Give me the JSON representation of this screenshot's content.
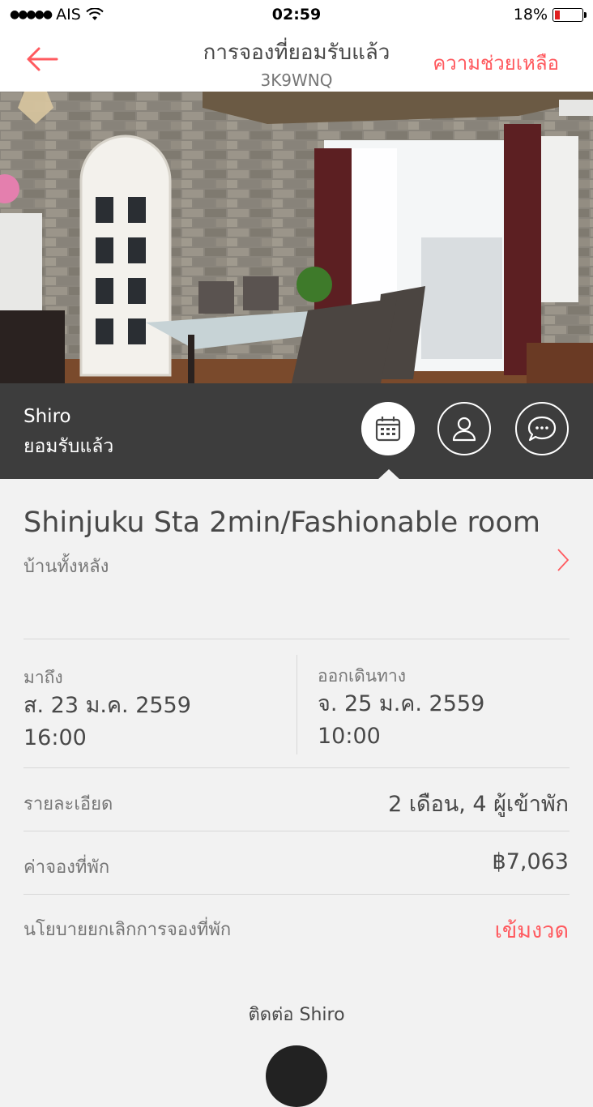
{
  "status_bar": {
    "carrier": "AIS",
    "time": "02:59",
    "battery": "18%"
  },
  "nav": {
    "title": "การจองที่ยอมรับแล้ว",
    "code": "3K9WNQ",
    "help": "ความช่วยเหลือ"
  },
  "host": {
    "name": "Shiro",
    "status": "ยอมรับแล้ว"
  },
  "listing": {
    "title": "Shinjuku Sta 2min/Fashionable room",
    "type": "บ้านทั้งหลัง"
  },
  "checkin": {
    "label": "มาถึง",
    "date": "ส. 23 ม.ค. 2559",
    "time": "16:00"
  },
  "checkout": {
    "label": "ออกเดินทาง",
    "date": "จ. 25 ม.ค. 2559",
    "time": "10:00"
  },
  "details": {
    "label": "รายละเอียด",
    "value": "2 เดือน, 4 ผู้เข้าพัก"
  },
  "price": {
    "label": "ค่าจองที่พัก",
    "value": "฿7,063"
  },
  "policy": {
    "label": "นโยบายยกเลิกการจองที่พัก",
    "value": "เข้มงวด"
  },
  "contact": {
    "label": "ติดต่อ Shiro"
  },
  "colors": {
    "accent": "#ff5a5f",
    "host_bar": "#3d3d3d",
    "background": "#f2f2f2"
  }
}
